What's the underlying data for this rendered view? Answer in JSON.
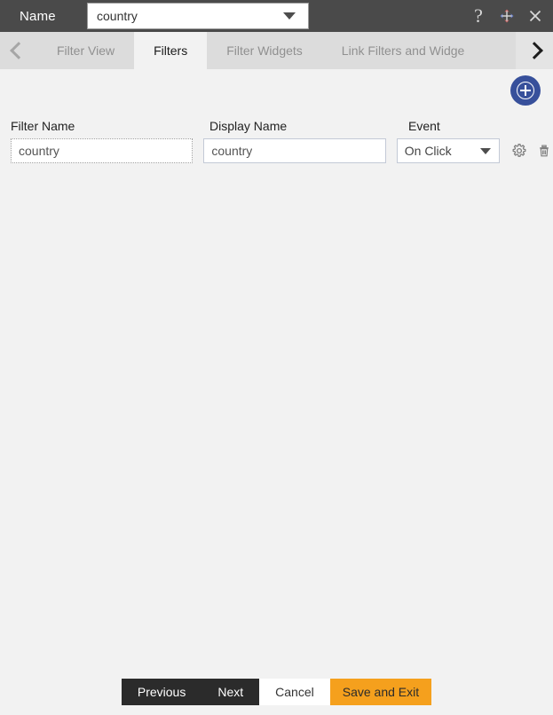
{
  "titlebar": {
    "label": "Name",
    "selected_value": "country",
    "icons": {
      "help": "?",
      "move": "move-icon",
      "close": "×"
    }
  },
  "tabbar": {
    "prev_arrow": "chevron-left-icon",
    "next_arrow": "chevron-right-icon",
    "tabs": [
      {
        "label": "Filter View",
        "active": false
      },
      {
        "label": "Filters",
        "active": true
      },
      {
        "label": "Filter Widgets",
        "active": false
      },
      {
        "label": "Link Filters and Widge",
        "active": false
      }
    ]
  },
  "content": {
    "add_button": "add-circle-icon",
    "columns": {
      "filter_name": "Filter Name",
      "display_name": "Display Name",
      "event": "Event"
    },
    "rows": [
      {
        "filter_name": "country",
        "display_name": "country",
        "event": "On Click",
        "settings_icon": "gear-icon",
        "delete_icon": "trash-icon"
      }
    ]
  },
  "footer": {
    "previous": "Previous",
    "next": "Next",
    "cancel": "Cancel",
    "save_and_exit": "Save and Exit"
  },
  "colors": {
    "titlebar": "#4a4a4a",
    "tab_inactive": "#dcdcdc",
    "tab_active": "#f2f2f2",
    "background": "#f2f2f2",
    "add_button": "#37509b",
    "accent": "#f5a01d",
    "dark_button": "#2b2b2b"
  }
}
